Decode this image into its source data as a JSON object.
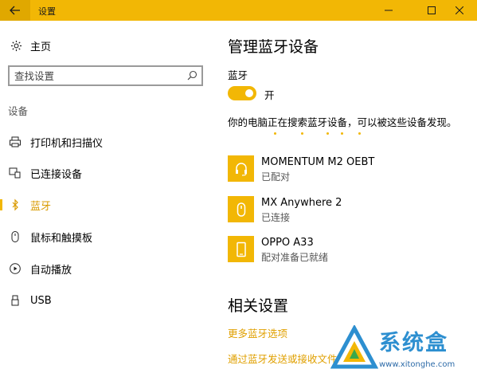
{
  "window": {
    "title": "设置",
    "accent_color": "#f2b705",
    "controls": [
      "minimize-icon",
      "maximize-icon",
      "close-icon"
    ]
  },
  "sidebar": {
    "home_label": "主页",
    "search": {
      "placeholder": "查找设置",
      "value": ""
    },
    "section_label": "设备",
    "items": [
      {
        "label": "打印机和扫描仪",
        "icon": "printer-icon",
        "active": false
      },
      {
        "label": "已连接设备",
        "icon": "connected-devices-icon",
        "active": false
      },
      {
        "label": "蓝牙",
        "icon": "bluetooth-icon",
        "active": true
      },
      {
        "label": "鼠标和触摸板",
        "icon": "mouse-icon",
        "active": false
      },
      {
        "label": "自动播放",
        "icon": "autoplay-icon",
        "active": false
      },
      {
        "label": "USB",
        "icon": "usb-icon",
        "active": false
      }
    ]
  },
  "main": {
    "title": "管理蓝牙设备",
    "bluetooth_label": "蓝牙",
    "toggle": {
      "state_label": "开",
      "on": true
    },
    "description": "你的电脑正在搜索蓝牙设备，可以被这些设备发现。",
    "devices": [
      {
        "name": "MOMENTUM M2 OEBT",
        "status": "已配对",
        "icon": "headset-icon"
      },
      {
        "name": "MX Anywhere 2",
        "status": "已连接",
        "icon": "mouse-icon"
      },
      {
        "name": "OPPO A33",
        "status": "配对准备已就绪",
        "icon": "phone-icon"
      }
    ],
    "related_title": "相关设置",
    "related_links": [
      "更多蓝牙选项",
      "通过蓝牙发送或接收文件"
    ]
  },
  "watermark": {
    "name": "系统盒",
    "url": "www.xitonghe.com"
  }
}
